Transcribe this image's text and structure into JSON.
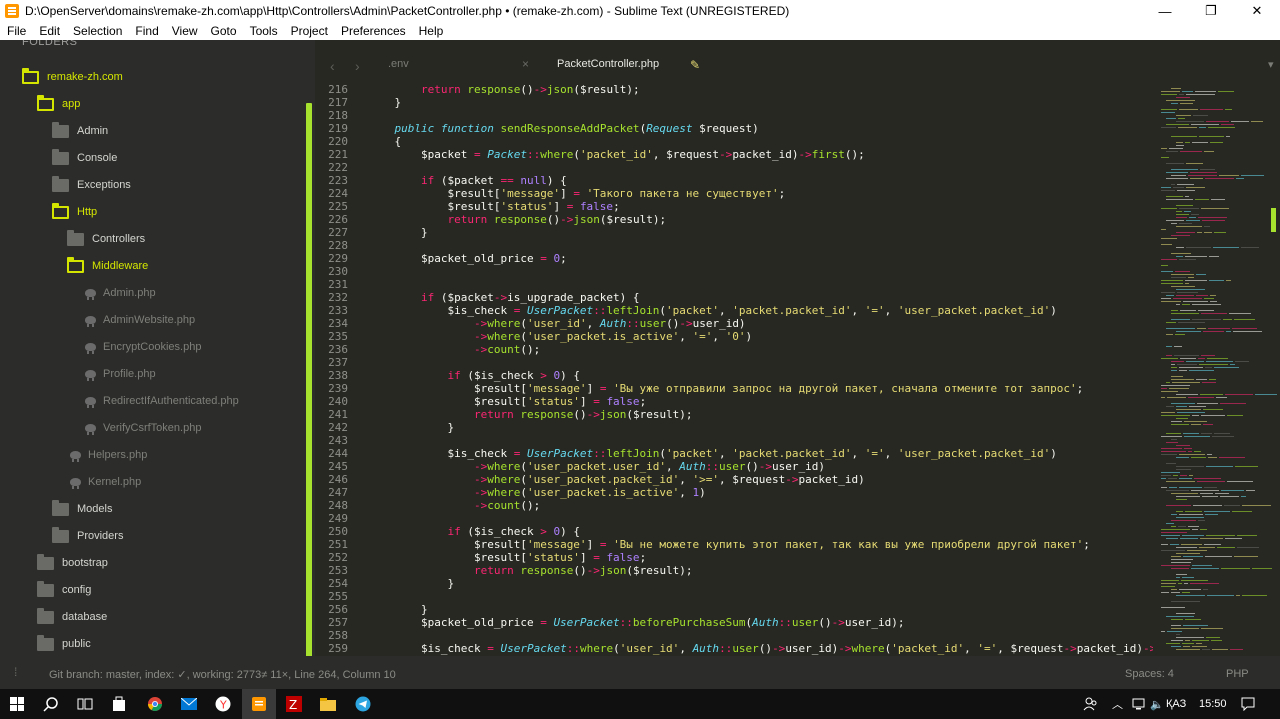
{
  "window": {
    "title": "D:\\OpenServer\\domains\\remake-zh.com\\app\\Http\\Controllers\\Admin\\PacketController.php • (remake-zh.com) - Sublime Text (UNREGISTERED)",
    "minimize": "—",
    "maximize": "❐",
    "close": "✕"
  },
  "menu": [
    "File",
    "Edit",
    "Selection",
    "Find",
    "View",
    "Goto",
    "Tools",
    "Project",
    "Preferences",
    "Help"
  ],
  "sidebar": {
    "header": "FOLDERS",
    "items": [
      {
        "label": "remake-zh.com",
        "kind": "open-folder"
      },
      {
        "label": "app",
        "kind": "open-folder"
      },
      {
        "label": "Admin",
        "kind": "folder"
      },
      {
        "label": "Console",
        "kind": "folder"
      },
      {
        "label": "Exceptions",
        "kind": "folder"
      },
      {
        "label": "Http",
        "kind": "open-folder"
      },
      {
        "label": "Controllers",
        "kind": "folder"
      },
      {
        "label": "Middleware",
        "kind": "open-folder"
      },
      {
        "label": "Admin.php",
        "kind": "file"
      },
      {
        "label": "AdminWebsite.php",
        "kind": "file"
      },
      {
        "label": "EncryptCookies.php",
        "kind": "file"
      },
      {
        "label": "Profile.php",
        "kind": "file"
      },
      {
        "label": "RedirectIfAuthenticated.php",
        "kind": "file"
      },
      {
        "label": "VerifyCsrfToken.php",
        "kind": "file"
      },
      {
        "label": "Helpers.php",
        "kind": "file"
      },
      {
        "label": "Kernel.php",
        "kind": "file"
      },
      {
        "label": "Models",
        "kind": "folder"
      },
      {
        "label": "Providers",
        "kind": "folder"
      },
      {
        "label": "bootstrap",
        "kind": "folder"
      },
      {
        "label": "config",
        "kind": "folder"
      },
      {
        "label": "database",
        "kind": "folder"
      },
      {
        "label": "public",
        "kind": "folder"
      }
    ]
  },
  "tabs": {
    "nav_prev": "‹",
    "nav_next": "›",
    "items": [
      {
        "label": ".env",
        "active": false,
        "close": "×"
      },
      {
        "label": "PacketController.php",
        "active": true,
        "dirty": "✎"
      }
    ],
    "dropdown": "▾"
  },
  "editor": {
    "lines": [
      {
        "n": "216",
        "t": "        return response()->json($result);"
      },
      {
        "n": "217",
        "t": "    }"
      },
      {
        "n": "218",
        "t": ""
      },
      {
        "n": "219",
        "t": "    public function sendResponseAddPacket(Request $request)"
      },
      {
        "n": "220",
        "t": "    {"
      },
      {
        "n": "221",
        "t": "        $packet = Packet::where('packet_id', $request->packet_id)->first();"
      },
      {
        "n": "222",
        "t": ""
      },
      {
        "n": "223",
        "t": "        if ($packet == null) {"
      },
      {
        "n": "224",
        "t": "            $result['message'] = 'Такого пакета не существует';"
      },
      {
        "n": "225",
        "t": "            $result['status'] = false;"
      },
      {
        "n": "226",
        "t": "            return response()->json($result);"
      },
      {
        "n": "227",
        "t": "        }"
      },
      {
        "n": "228",
        "t": ""
      },
      {
        "n": "229",
        "t": "        $packet_old_price = 0;"
      },
      {
        "n": "230",
        "t": ""
      },
      {
        "n": "231",
        "t": ""
      },
      {
        "n": "232",
        "t": "        if ($packet->is_upgrade_packet) {"
      },
      {
        "n": "233",
        "t": "            $is_check = UserPacket::leftJoin('packet', 'packet.packet_id', '=', 'user_packet.packet_id')"
      },
      {
        "n": "234",
        "t": "                ->where('user_id', Auth::user()->user_id)"
      },
      {
        "n": "235",
        "t": "                ->where('user_packet.is_active', '=', '0')"
      },
      {
        "n": "236",
        "t": "                ->count();"
      },
      {
        "n": "237",
        "t": ""
      },
      {
        "n": "238",
        "t": "            if ($is_check > 0) {"
      },
      {
        "n": "239",
        "t": "                $result['message'] = 'Вы уже отправили запрос на другой пакет, сначала отмените тот запрос';"
      },
      {
        "n": "240",
        "t": "                $result['status'] = false;"
      },
      {
        "n": "241",
        "t": "                return response()->json($result);"
      },
      {
        "n": "242",
        "t": "            }"
      },
      {
        "n": "243",
        "t": ""
      },
      {
        "n": "244",
        "t": "            $is_check = UserPacket::leftJoin('packet', 'packet.packet_id', '=', 'user_packet.packet_id')"
      },
      {
        "n": "245",
        "t": "                ->where('user_packet.user_id', Auth::user()->user_id)"
      },
      {
        "n": "246",
        "t": "                ->where('user_packet.packet_id', '>=', $request->packet_id)"
      },
      {
        "n": "247",
        "t": "                ->where('user_packet.is_active', 1)"
      },
      {
        "n": "248",
        "t": "                ->count();"
      },
      {
        "n": "249",
        "t": ""
      },
      {
        "n": "250",
        "t": "            if ($is_check > 0) {"
      },
      {
        "n": "251",
        "t": "                $result['message'] = 'Вы не можете купить этот пакет, так как вы уже приобрели другой пакет';"
      },
      {
        "n": "252",
        "t": "                $result['status'] = false;"
      },
      {
        "n": "253",
        "t": "                return response()->json($result);"
      },
      {
        "n": "254",
        "t": "            }"
      },
      {
        "n": "255",
        "t": ""
      },
      {
        "n": "256",
        "t": "        }"
      },
      {
        "n": "257",
        "t": "        $packet_old_price = UserPacket::beforePurchaseSum(Auth::user()->user_id);"
      },
      {
        "n": "258",
        "t": ""
      },
      {
        "n": "259",
        "t": "        $is_check = UserPacket::where('user_id', Auth::user()->user_id)->where('packet_id', '=', $request->packet_id)->"
      }
    ]
  },
  "status": {
    "left": "Git branch: master, index: ✓, working: 2773≠ 11×, Line 264, Column 10",
    "spaces": "Spaces: 4",
    "syntax": "PHP"
  },
  "taskbar": {
    "lang": "ҚАЗ",
    "time": "15:50"
  },
  "colors": {
    "editor_bg": "#272822",
    "sidebar_bg": "#2c2c2a",
    "accent_yellow": "#d4e600",
    "keyword": "#f92672",
    "function": "#a6e22e",
    "string": "#e6db74",
    "number": "#ae81ff",
    "class": "#66d9ef"
  }
}
